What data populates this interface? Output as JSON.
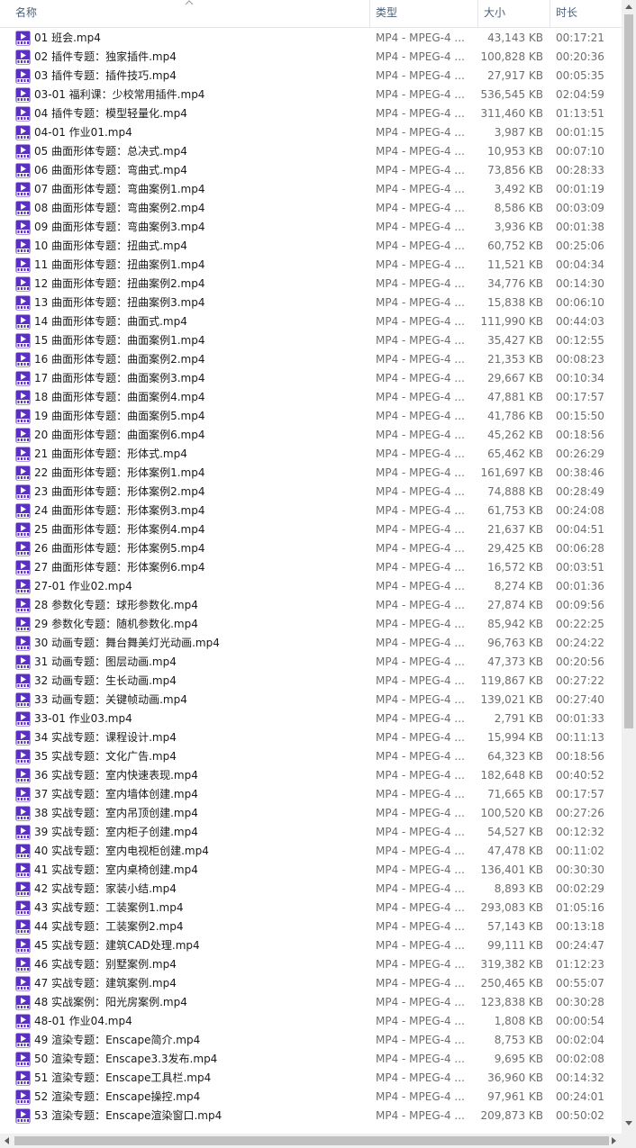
{
  "columns": {
    "name": "名称",
    "type": "类型",
    "size": "大小",
    "duration": "时长"
  },
  "icon": "mp4-video-file-icon",
  "colors": {
    "icon_purple": "#5a2fc2",
    "header_text": "#4c607a"
  },
  "files": [
    {
      "name": "01 班会.mp4",
      "type": "MP4 - MPEG-4 ...",
      "size": "43,143 KB",
      "duration": "00:17:21"
    },
    {
      "name": "02 插件专题：独家插件.mp4",
      "type": "MP4 - MPEG-4 ...",
      "size": "100,828 KB",
      "duration": "00:20:36"
    },
    {
      "name": "03 插件专题：插件技巧.mp4",
      "type": "MP4 - MPEG-4 ...",
      "size": "27,917 KB",
      "duration": "00:05:35"
    },
    {
      "name": "03-01 福利课：少校常用插件.mp4",
      "type": "MP4 - MPEG-4 ...",
      "size": "536,545 KB",
      "duration": "02:04:59"
    },
    {
      "name": "04 插件专题：模型轻量化.mp4",
      "type": "MP4 - MPEG-4 ...",
      "size": "311,460 KB",
      "duration": "01:13:51"
    },
    {
      "name": "04-01 作业01.mp4",
      "type": "MP4 - MPEG-4 ...",
      "size": "3,987 KB",
      "duration": "00:01:15"
    },
    {
      "name": "05 曲面形体专题：总决式.mp4",
      "type": "MP4 - MPEG-4 ...",
      "size": "10,953 KB",
      "duration": "00:07:10"
    },
    {
      "name": "06 曲面形体专题：弯曲式.mp4",
      "type": "MP4 - MPEG-4 ...",
      "size": "73,856 KB",
      "duration": "00:28:33"
    },
    {
      "name": "07 曲面形体专题：弯曲案例1.mp4",
      "type": "MP4 - MPEG-4 ...",
      "size": "3,492 KB",
      "duration": "00:01:19"
    },
    {
      "name": "08 曲面形体专题：弯曲案例2.mp4",
      "type": "MP4 - MPEG-4 ...",
      "size": "8,586 KB",
      "duration": "00:03:09"
    },
    {
      "name": "09 曲面形体专题：弯曲案例3.mp4",
      "type": "MP4 - MPEG-4 ...",
      "size": "3,936 KB",
      "duration": "00:01:38"
    },
    {
      "name": "10 曲面形体专题：扭曲式.mp4",
      "type": "MP4 - MPEG-4 ...",
      "size": "60,752 KB",
      "duration": "00:25:06"
    },
    {
      "name": "11 曲面形体专题：扭曲案例1.mp4",
      "type": "MP4 - MPEG-4 ...",
      "size": "11,521 KB",
      "duration": "00:04:34"
    },
    {
      "name": "12 曲面形体专题：扭曲案例2.mp4",
      "type": "MP4 - MPEG-4 ...",
      "size": "34,776 KB",
      "duration": "00:14:30"
    },
    {
      "name": "13 曲面形体专题：扭曲案例3.mp4",
      "type": "MP4 - MPEG-4 ...",
      "size": "15,838 KB",
      "duration": "00:06:10"
    },
    {
      "name": "14 曲面形体专题：曲面式.mp4",
      "type": "MP4 - MPEG-4 ...",
      "size": "111,990 KB",
      "duration": "00:44:03"
    },
    {
      "name": "15 曲面形体专题：曲面案例1.mp4",
      "type": "MP4 - MPEG-4 ...",
      "size": "35,427 KB",
      "duration": "00:12:55"
    },
    {
      "name": "16 曲面形体专题：曲面案例2.mp4",
      "type": "MP4 - MPEG-4 ...",
      "size": "21,353 KB",
      "duration": "00:08:23"
    },
    {
      "name": "17 曲面形体专题：曲面案例3.mp4",
      "type": "MP4 - MPEG-4 ...",
      "size": "29,667 KB",
      "duration": "00:10:34"
    },
    {
      "name": "18 曲面形体专题：曲面案例4.mp4",
      "type": "MP4 - MPEG-4 ...",
      "size": "47,881 KB",
      "duration": "00:17:57"
    },
    {
      "name": "19 曲面形体专题：曲面案例5.mp4",
      "type": "MP4 - MPEG-4 ...",
      "size": "41,786 KB",
      "duration": "00:15:50"
    },
    {
      "name": "20 曲面形体专题：曲面案例6.mp4",
      "type": "MP4 - MPEG-4 ...",
      "size": "45,262 KB",
      "duration": "00:18:56"
    },
    {
      "name": "21 曲面形体专题：形体式.mp4",
      "type": "MP4 - MPEG-4 ...",
      "size": "65,462 KB",
      "duration": "00:26:29"
    },
    {
      "name": "22 曲面形体专题：形体案例1.mp4",
      "type": "MP4 - MPEG-4 ...",
      "size": "161,697 KB",
      "duration": "00:38:46"
    },
    {
      "name": "23 曲面形体专题：形体案例2.mp4",
      "type": "MP4 - MPEG-4 ...",
      "size": "74,888 KB",
      "duration": "00:28:49"
    },
    {
      "name": "24 曲面形体专题：形体案例3.mp4",
      "type": "MP4 - MPEG-4 ...",
      "size": "61,753 KB",
      "duration": "00:24:08"
    },
    {
      "name": "25 曲面形体专题：形体案例4.mp4",
      "type": "MP4 - MPEG-4 ...",
      "size": "21,637 KB",
      "duration": "00:04:51"
    },
    {
      "name": "26 曲面形体专题：形体案例5.mp4",
      "type": "MP4 - MPEG-4 ...",
      "size": "29,425 KB",
      "duration": "00:06:28"
    },
    {
      "name": "27 曲面形体专题：形体案例6.mp4",
      "type": "MP4 - MPEG-4 ...",
      "size": "16,572 KB",
      "duration": "00:03:51"
    },
    {
      "name": "27-01 作业02.mp4",
      "type": "MP4 - MPEG-4 ...",
      "size": "8,274 KB",
      "duration": "00:01:36"
    },
    {
      "name": "28 参数化专题：球形参数化.mp4",
      "type": "MP4 - MPEG-4 ...",
      "size": "27,874 KB",
      "duration": "00:09:56"
    },
    {
      "name": "29 参数化专题：随机参数化.mp4",
      "type": "MP4 - MPEG-4 ...",
      "size": "85,942 KB",
      "duration": "00:22:25"
    },
    {
      "name": "30 动画专题：舞台舞美灯光动画.mp4",
      "type": "MP4 - MPEG-4 ...",
      "size": "96,763 KB",
      "duration": "00:24:22"
    },
    {
      "name": "31 动画专题：图层动画.mp4",
      "type": "MP4 - MPEG-4 ...",
      "size": "47,373 KB",
      "duration": "00:20:56"
    },
    {
      "name": "32 动画专题：生长动画.mp4",
      "type": "MP4 - MPEG-4 ...",
      "size": "119,867 KB",
      "duration": "00:27:22"
    },
    {
      "name": "33 动画专题：关键帧动画.mp4",
      "type": "MP4 - MPEG-4 ...",
      "size": "139,021 KB",
      "duration": "00:27:40"
    },
    {
      "name": "33-01 作业03.mp4",
      "type": "MP4 - MPEG-4 ...",
      "size": "2,791 KB",
      "duration": "00:01:33"
    },
    {
      "name": "34 实战专题：课程设计.mp4",
      "type": "MP4 - MPEG-4 ...",
      "size": "15,994 KB",
      "duration": "00:11:13"
    },
    {
      "name": "35 实战专题：文化广告.mp4",
      "type": "MP4 - MPEG-4 ...",
      "size": "64,323 KB",
      "duration": "00:18:56"
    },
    {
      "name": "36 实战专题：室内快速表现.mp4",
      "type": "MP4 - MPEG-4 ...",
      "size": "182,648 KB",
      "duration": "00:40:52"
    },
    {
      "name": "37 实战专题：室内墙体创建.mp4",
      "type": "MP4 - MPEG-4 ...",
      "size": "71,665 KB",
      "duration": "00:17:57"
    },
    {
      "name": "38 实战专题：室内吊顶创建.mp4",
      "type": "MP4 - MPEG-4 ...",
      "size": "100,520 KB",
      "duration": "00:27:26"
    },
    {
      "name": "39 实战专题：室内柜子创建.mp4",
      "type": "MP4 - MPEG-4 ...",
      "size": "54,527 KB",
      "duration": "00:12:32"
    },
    {
      "name": "40 实战专题：室内电视柜创建.mp4",
      "type": "MP4 - MPEG-4 ...",
      "size": "47,478 KB",
      "duration": "00:11:02"
    },
    {
      "name": "41 实战专题：室内桌椅创建.mp4",
      "type": "MP4 - MPEG-4 ...",
      "size": "136,401 KB",
      "duration": "00:30:30"
    },
    {
      "name": "42 实战专题：家装小结.mp4",
      "type": "MP4 - MPEG-4 ...",
      "size": "8,893 KB",
      "duration": "00:02:29"
    },
    {
      "name": "43 实战专题：工装案例1.mp4",
      "type": "MP4 - MPEG-4 ...",
      "size": "293,083 KB",
      "duration": "01:05:16"
    },
    {
      "name": "44 实战专题：工装案例2.mp4",
      "type": "MP4 - MPEG-4 ...",
      "size": "57,143 KB",
      "duration": "00:13:18"
    },
    {
      "name": "45 实战专题：建筑CAD处理.mp4",
      "type": "MP4 - MPEG-4 ...",
      "size": "99,111 KB",
      "duration": "00:24:47"
    },
    {
      "name": "46 实战专题：别墅案例.mp4",
      "type": "MP4 - MPEG-4 ...",
      "size": "319,382 KB",
      "duration": "01:12:23"
    },
    {
      "name": "47 实战专题：建筑案例.mp4",
      "type": "MP4 - MPEG-4 ...",
      "size": "250,465 KB",
      "duration": "00:55:07"
    },
    {
      "name": "48 实战案例：阳光房案例.mp4",
      "type": "MP4 - MPEG-4 ...",
      "size": "123,838 KB",
      "duration": "00:30:28"
    },
    {
      "name": "48-01 作业04.mp4",
      "type": "MP4 - MPEG-4 ...",
      "size": "1,808 KB",
      "duration": "00:00:54"
    },
    {
      "name": "49 渲染专题：Enscape简介.mp4",
      "type": "MP4 - MPEG-4 ...",
      "size": "8,753 KB",
      "duration": "00:02:04"
    },
    {
      "name": "50 渲染专题：Enscape3.3发布.mp4",
      "type": "MP4 - MPEG-4 ...",
      "size": "9,695 KB",
      "duration": "00:02:08"
    },
    {
      "name": "51 渲染专题：Enscape工具栏.mp4",
      "type": "MP4 - MPEG-4 ...",
      "size": "36,960 KB",
      "duration": "00:14:32"
    },
    {
      "name": "52 渲染专题：Enscape操控.mp4",
      "type": "MP4 - MPEG-4 ...",
      "size": "97,961 KB",
      "duration": "00:24:01"
    },
    {
      "name": "53 渲染专题：Enscape渲染窗口.mp4",
      "type": "MP4 - MPEG-4 ...",
      "size": "209,873 KB",
      "duration": "00:50:02"
    }
  ]
}
